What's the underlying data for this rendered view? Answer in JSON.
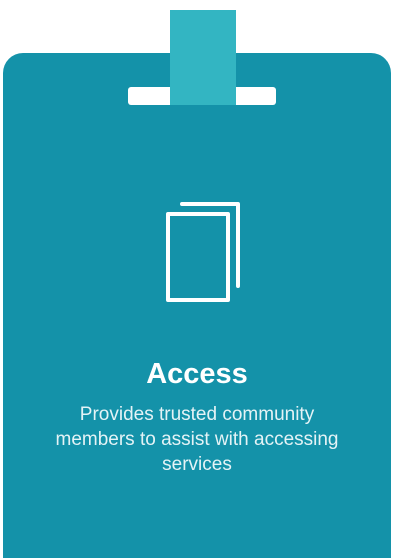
{
  "card": {
    "title": "Access",
    "description": "Provides trusted community members to assist with accessing services",
    "icon": "documents-icon"
  },
  "colors": {
    "card_background": "#1492a9",
    "strap": "#33b5c2",
    "clip": "#ffffff",
    "text": "#ffffff"
  }
}
